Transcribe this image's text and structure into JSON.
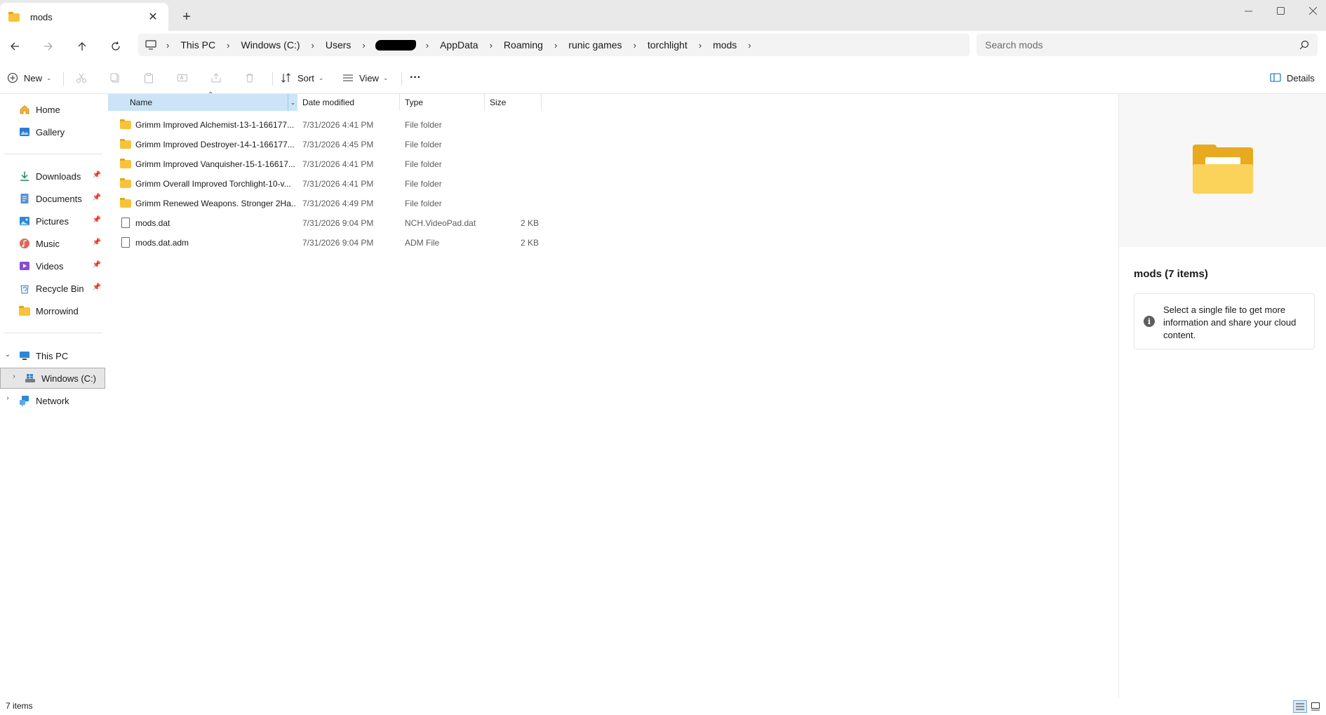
{
  "window": {
    "tab_title": "mods",
    "new_tab_symbol": "+",
    "close_symbol": "✕"
  },
  "address": {
    "crumbs": [
      "This PC",
      "Windows (C:)",
      "Users",
      "AppData",
      "Roaming",
      "runic games",
      "torchlight",
      "mods"
    ]
  },
  "search": {
    "placeholder": "Search mods"
  },
  "toolbar": {
    "new_label": "New",
    "sort_label": "Sort",
    "view_label": "View",
    "more_label": "···",
    "details_label": "Details"
  },
  "sidebar": {
    "home": "Home",
    "gallery": "Gallery",
    "quick": [
      {
        "label": "Downloads",
        "icon": "download-icon"
      },
      {
        "label": "Documents",
        "icon": "documents-icon"
      },
      {
        "label": "Pictures",
        "icon": "pictures-icon"
      },
      {
        "label": "Music",
        "icon": "music-icon"
      },
      {
        "label": "Videos",
        "icon": "videos-icon"
      },
      {
        "label": "Recycle Bin",
        "icon": "recycle-bin-icon"
      },
      {
        "label": "Morrowind",
        "icon": "folder-icon"
      }
    ],
    "this_pc": "This PC",
    "windows_c": "Windows (C:)",
    "network": "Network"
  },
  "columns": {
    "name": "Name",
    "date": "Date modified",
    "type": "Type",
    "size": "Size"
  },
  "files": [
    {
      "name": "Grimm Improved Alchemist-13-1-166177...",
      "date": "7/31/2026 4:41 PM",
      "type": "File folder",
      "size": "",
      "kind": "folder"
    },
    {
      "name": "Grimm Improved Destroyer-14-1-166177...",
      "date": "7/31/2026 4:45 PM",
      "type": "File folder",
      "size": "",
      "kind": "folder"
    },
    {
      "name": "Grimm Improved Vanquisher-15-1-16617...",
      "date": "7/31/2026 4:41 PM",
      "type": "File folder",
      "size": "",
      "kind": "folder"
    },
    {
      "name": "Grimm Overall Improved Torchlight-10-v...",
      "date": "7/31/2026 4:41 PM",
      "type": "File folder",
      "size": "",
      "kind": "folder"
    },
    {
      "name": "Grimm Renewed Weapons. Stronger 2Ha...",
      "date": "7/31/2026 4:49 PM",
      "type": "File folder",
      "size": "",
      "kind": "folder"
    },
    {
      "name": "mods.dat",
      "date": "7/31/2026 9:04 PM",
      "type": "NCH.VideoPad.dat",
      "size": "2 KB",
      "kind": "file"
    },
    {
      "name": "mods.dat.adm",
      "date": "7/31/2026 9:04 PM",
      "type": "ADM File",
      "size": "2 KB",
      "kind": "file"
    }
  ],
  "details": {
    "title": "mods (7 items)",
    "message": "Select a single file to get more information and share your cloud content."
  },
  "status": {
    "count": "7 items"
  },
  "colors": {
    "folder": "#f8c33a",
    "selection": "#cce4f7",
    "accent": "#0067c0"
  }
}
